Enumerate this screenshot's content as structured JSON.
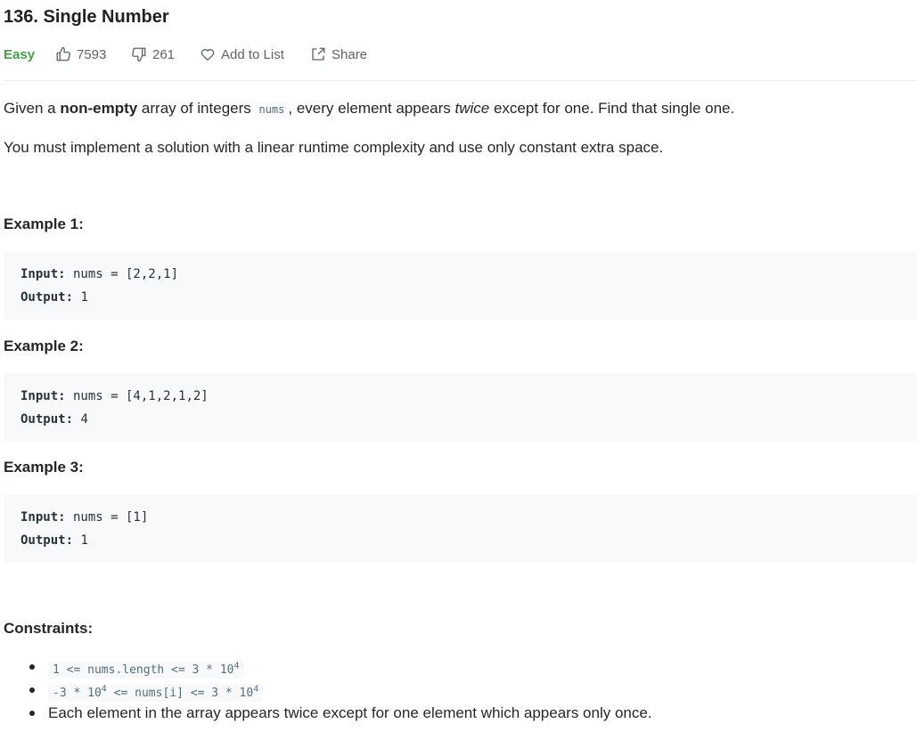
{
  "problem": {
    "title": "136. Single Number",
    "difficulty": "Easy",
    "likes": "7593",
    "dislikes": "261",
    "add_to_list": "Add to List",
    "share": "Share"
  },
  "description": {
    "p1_pre": "Given a ",
    "p1_bold": "non-empty",
    "p1_mid": " array of integers ",
    "p1_code": "nums",
    "p1_mid2": ", every element appears ",
    "p1_italic": "twice",
    "p1_post": " except for one. Find that single one.",
    "p2": "You must implement a solution with a linear runtime complexity and use only constant extra space."
  },
  "examples": [
    {
      "title": "Example 1:",
      "input_label": "Input:",
      "input": " nums = [2,2,1]",
      "output_label": "Output:",
      "output": " 1"
    },
    {
      "title": "Example 2:",
      "input_label": "Input:",
      "input": " nums = [4,1,2,1,2]",
      "output_label": "Output:",
      "output": " 4"
    },
    {
      "title": "Example 3:",
      "input_label": "Input:",
      "input": " nums = [1]",
      "output_label": "Output:",
      "output": " 1"
    }
  ],
  "constraints": {
    "title": "Constraints:",
    "c1_pre": "1 <= nums.length <= 3 * 10",
    "c1_sup": "4",
    "c2_a": "-3 * 10",
    "c2_sup1": "4",
    "c2_b": " <= nums[i] <= 3 * 10",
    "c2_sup2": "4",
    "c3": "Each element in the array appears twice except for one element which appears only once."
  },
  "icons": {
    "like": "thumbs-up-icon",
    "dislike": "thumbs-down-icon",
    "add_to_list": "heart-icon",
    "share": "share-icon"
  },
  "colors": {
    "easy": "#43a047",
    "code_bg": "#f7f9fa"
  }
}
